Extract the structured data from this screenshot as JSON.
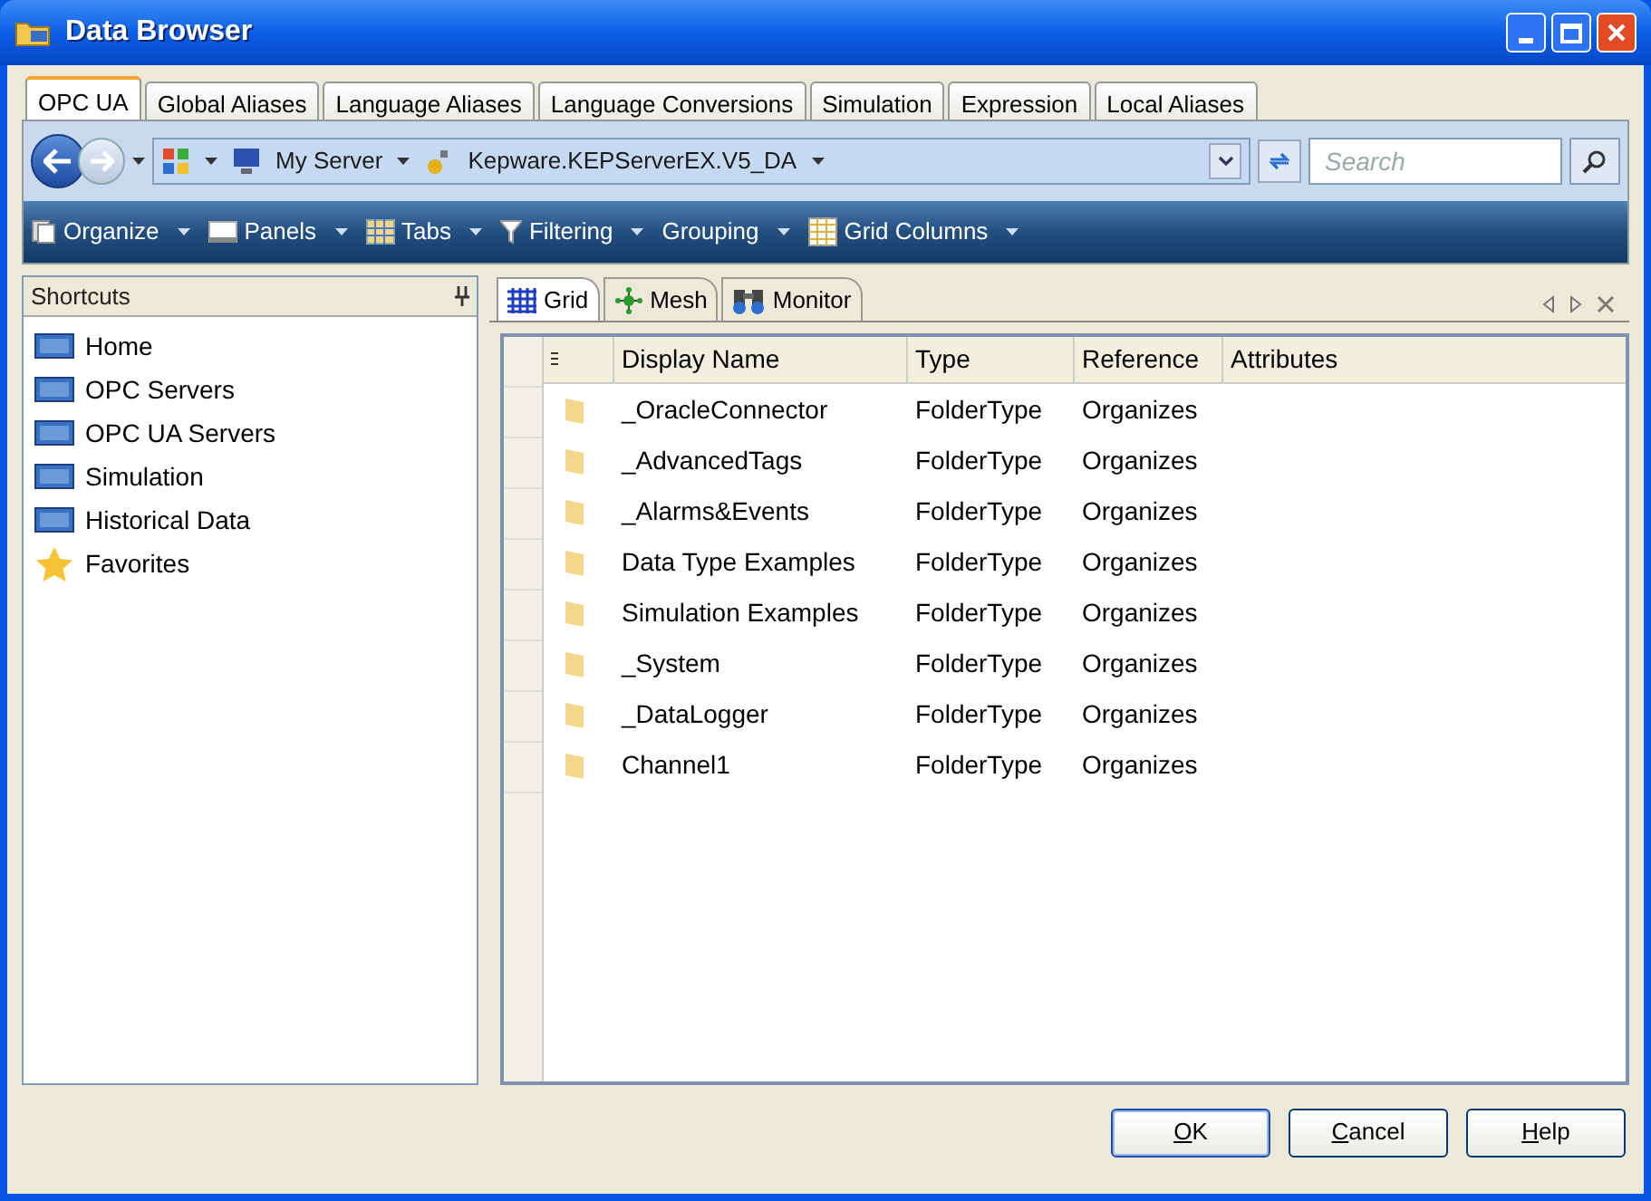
{
  "window": {
    "title": "Data Browser"
  },
  "tabs": [
    {
      "label": "OPC UA",
      "selected": true
    },
    {
      "label": "Global Aliases",
      "selected": false
    },
    {
      "label": "Language Aliases",
      "selected": false
    },
    {
      "label": "Language Conversions",
      "selected": false
    },
    {
      "label": "Simulation",
      "selected": false
    },
    {
      "label": "Expression",
      "selected": false
    },
    {
      "label": "Local Aliases",
      "selected": false
    }
  ],
  "address_bar": {
    "segments": [
      {
        "kind": "root"
      },
      {
        "kind": "computer",
        "label": "My Server"
      },
      {
        "kind": "server",
        "label": "Kepware.KEPServerEX.V5_DA"
      }
    ],
    "search": {
      "placeholder": "Search"
    }
  },
  "toolbar": [
    {
      "kind": "pages",
      "label": "Organize"
    },
    {
      "kind": "panel",
      "label": "Panels"
    },
    {
      "kind": "tabs",
      "label": "Tabs"
    },
    {
      "kind": "filter",
      "label": "Filtering"
    },
    {
      "kind": "none",
      "label": "Grouping"
    },
    {
      "kind": "columns",
      "label": "Grid Columns"
    }
  ],
  "shortcuts": {
    "title": "Shortcuts",
    "items": [
      {
        "kind": "screen",
        "label": "Home"
      },
      {
        "kind": "screen",
        "label": "OPC Servers"
      },
      {
        "kind": "screen",
        "label": "OPC UA Servers"
      },
      {
        "kind": "screen",
        "label": "Simulation"
      },
      {
        "kind": "screen",
        "label": "Historical Data"
      },
      {
        "kind": "star",
        "label": "Favorites"
      }
    ]
  },
  "view_tabs": [
    {
      "kind": "grid",
      "label": "Grid",
      "selected": true
    },
    {
      "kind": "mesh",
      "label": "Mesh",
      "selected": false
    },
    {
      "kind": "monitor",
      "label": "Monitor",
      "selected": false
    }
  ],
  "table": {
    "columns": [
      "Display Name",
      "Type",
      "Reference",
      "Attributes"
    ],
    "rows": [
      [
        "_OracleConnector",
        "FolderType",
        "Organizes"
      ],
      [
        "_AdvancedTags",
        "FolderType",
        "Organizes"
      ],
      [
        "_Alarms&Events",
        "FolderType",
        "Organizes"
      ],
      [
        "Data Type Examples",
        "FolderType",
        "Organizes"
      ],
      [
        "Simulation Examples",
        "FolderType",
        "Organizes"
      ],
      [
        "_System",
        "FolderType",
        "Organizes"
      ],
      [
        "_DataLogger",
        "FolderType",
        "Organizes"
      ],
      [
        "Channel1",
        "FolderType",
        "Organizes"
      ]
    ]
  },
  "buttons": [
    {
      "label": "OK",
      "default": true
    },
    {
      "label": "Cancel",
      "default": false
    },
    {
      "label": "Help",
      "default": false
    }
  ]
}
